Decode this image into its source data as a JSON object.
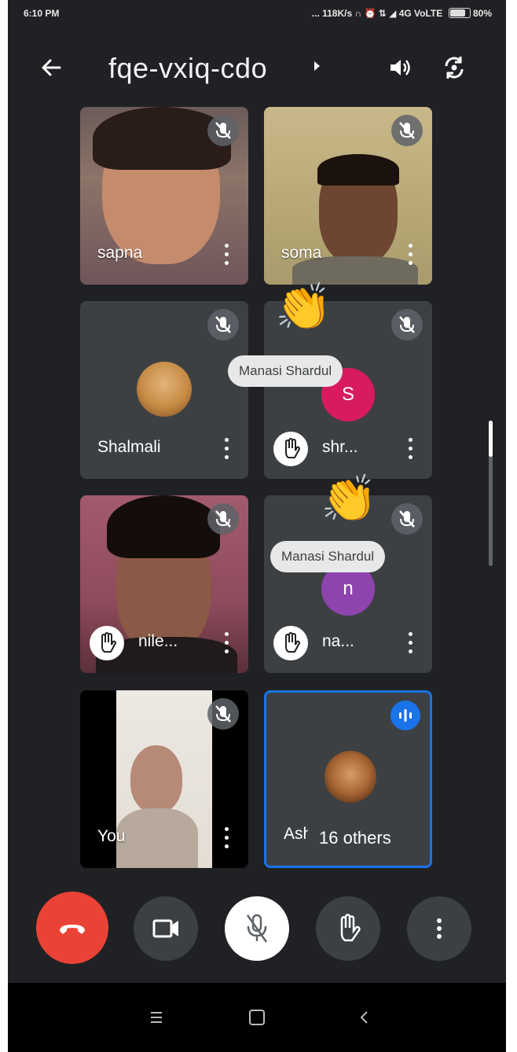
{
  "status_bar": {
    "time": "6:10 PM",
    "indicators": "... 118K/s ∩ ⏰ ⇅ ◢ 4G VoLTE",
    "battery": "80%"
  },
  "header": {
    "meeting_code": "fqe-vxiq-cdo",
    "back_icon": "back-arrow-icon",
    "speaker_icon": "speaker-icon",
    "switch_camera_icon": "switch-camera-icon"
  },
  "participants": [
    {
      "name": "sapna",
      "muted": true
    },
    {
      "name": "soma",
      "muted": true
    },
    {
      "name": "Shalmali",
      "muted": true
    },
    {
      "name": "shr...",
      "muted": true,
      "hand_raised": true,
      "initial": "S"
    },
    {
      "name": "nile...",
      "muted": true,
      "hand_raised": true
    },
    {
      "name": "na...",
      "muted": true,
      "hand_raised": true,
      "initial": "n"
    },
    {
      "name": "You",
      "muted": true
    },
    {
      "name": "Ash",
      "speaking": true
    }
  ],
  "reactions": [
    {
      "emoji": "👏",
      "by": "Manasi Shardul"
    },
    {
      "emoji": "👏",
      "by": "Manasi Shardul"
    }
  ],
  "others_chip": "16 others",
  "controls": {
    "end_call_icon": "end-call-icon",
    "camera_icon": "camera-icon",
    "mic_icon": "mic-off-icon",
    "raise_hand_icon": "raise-hand-icon",
    "more_icon": "more-options-icon"
  },
  "colors": {
    "background": "#202124",
    "end_call": "#ea4335",
    "speaking_border": "#1a73e8",
    "avatar_s": "#d81b60",
    "avatar_n": "#8e44ad"
  }
}
